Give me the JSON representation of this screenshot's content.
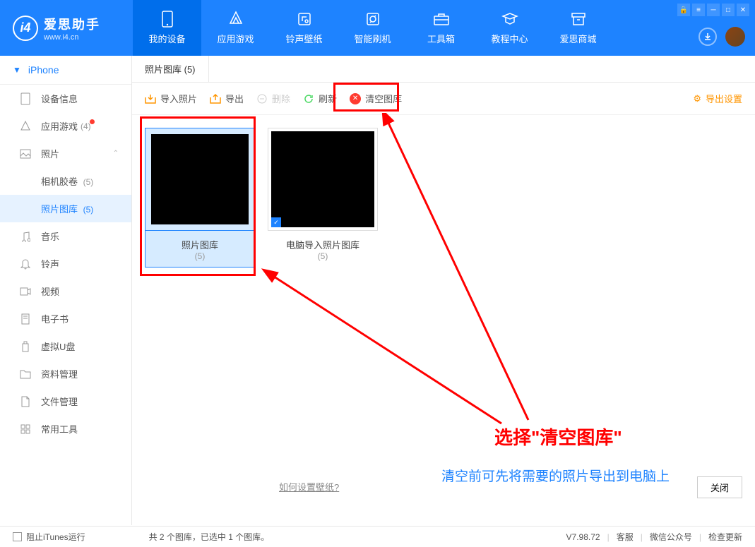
{
  "logo": {
    "title": "爱思助手",
    "sub": "www.i4.cn",
    "letter": "i4"
  },
  "nav": [
    {
      "label": "我的设备",
      "icon": "device"
    },
    {
      "label": "应用游戏",
      "icon": "apps"
    },
    {
      "label": "铃声壁纸",
      "icon": "ringtone"
    },
    {
      "label": "智能刷机",
      "icon": "flash"
    },
    {
      "label": "工具箱",
      "icon": "toolbox"
    },
    {
      "label": "教程中心",
      "icon": "tutorial"
    },
    {
      "label": "爱思商城",
      "icon": "shop"
    }
  ],
  "device_name": "iPhone",
  "sidebar": {
    "items": [
      {
        "label": "设备信息",
        "icon": "info"
      },
      {
        "label": "应用游戏",
        "count": "(4)",
        "badge": true
      },
      {
        "label": "照片",
        "expand": true
      },
      {
        "label": "音乐"
      },
      {
        "label": "铃声"
      },
      {
        "label": "视频"
      },
      {
        "label": "电子书"
      },
      {
        "label": "虚拟U盘"
      },
      {
        "label": "资料管理"
      },
      {
        "label": "文件管理"
      },
      {
        "label": "常用工具"
      }
    ],
    "subs": [
      {
        "label": "相机胶卷",
        "count": "(5)"
      },
      {
        "label": "照片图库",
        "count": "(5)",
        "active": true
      }
    ]
  },
  "tab_label": "照片图库 (5)",
  "toolbar": {
    "import": "导入照片",
    "export": "导出",
    "delete": "删除",
    "refresh": "刷新",
    "clear": "清空图库",
    "export_setting": "导出设置"
  },
  "thumbs": [
    {
      "title": "照片图库",
      "count": "(5)",
      "selected": true
    },
    {
      "title": "电脑导入照片图库",
      "count": "(5)",
      "selected": false,
      "check": true
    }
  ],
  "annotation": {
    "title": "选择\"清空图库\"",
    "sub": "清空前可先将需要的照片导出到电脑上"
  },
  "bottom_link": "如何设置壁纸?",
  "close_label": "关闭",
  "status": {
    "itunes": "阻止iTunes运行",
    "summary": "共 2 个图库，已选中 1 个图库。",
    "version": "V7.98.72",
    "service": "客服",
    "wechat": "微信公众号",
    "update": "检查更新"
  }
}
